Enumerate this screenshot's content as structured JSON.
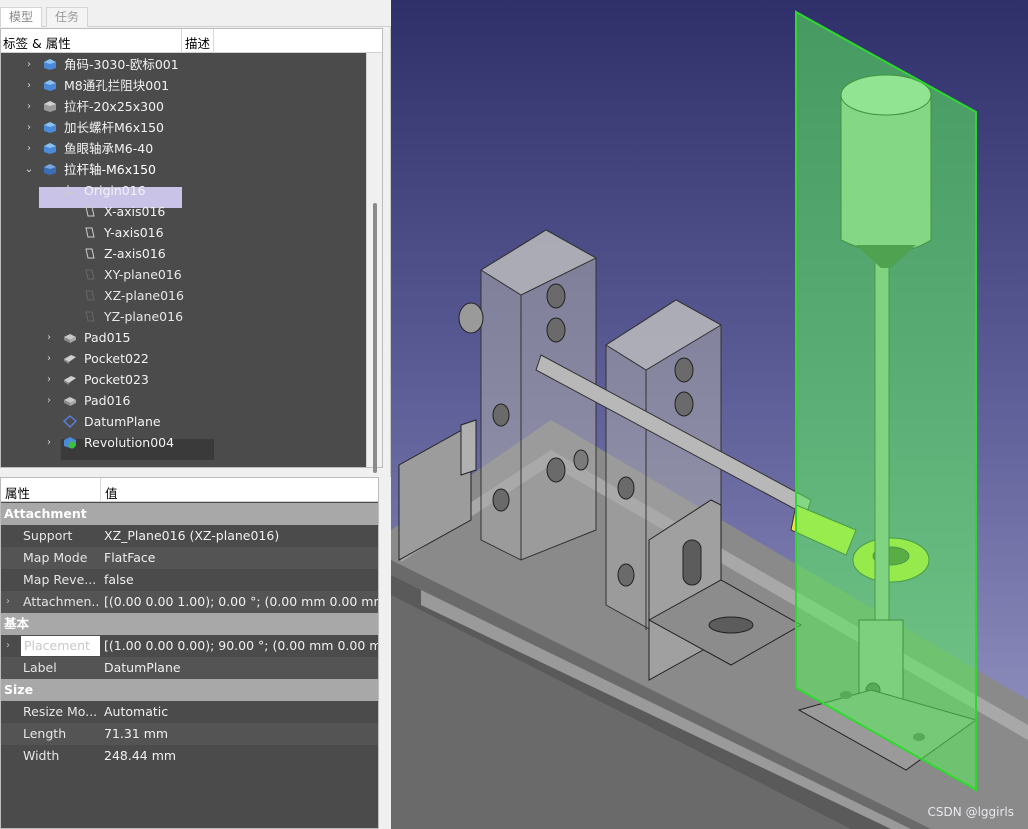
{
  "tabs": {
    "model": "模型",
    "task": "任务"
  },
  "tree": {
    "header": {
      "labels": "标签 & 属性",
      "description": "描述"
    },
    "items": [
      {
        "label": "角码-3030-欧标001",
        "icon": "part-link-icon"
      },
      {
        "label": "M8通孔拦阻块001",
        "icon": "part-link-icon"
      },
      {
        "label": "拉杆-20x25x300",
        "icon": "part-icon"
      },
      {
        "label": "加长螺杆M6x150",
        "icon": "part-link-icon"
      },
      {
        "label": "鱼眼轴承M6-40",
        "icon": "part-link-icon"
      },
      {
        "label": "拉杆轴-M6x150",
        "icon": "body-icon"
      },
      {
        "label": "Origin016",
        "icon": "origin-icon"
      },
      {
        "label": "X-axis016",
        "icon": "axis-icon"
      },
      {
        "label": "Y-axis016",
        "icon": "axis-icon"
      },
      {
        "label": "Z-axis016",
        "icon": "axis-icon"
      },
      {
        "label": "XY-plane016",
        "icon": "plane-icon"
      },
      {
        "label": "XZ-plane016",
        "icon": "plane-icon"
      },
      {
        "label": "YZ-plane016",
        "icon": "plane-icon"
      },
      {
        "label": "Pad015",
        "icon": "pad-icon"
      },
      {
        "label": "Pocket022",
        "icon": "pocket-icon"
      },
      {
        "label": "Pocket023",
        "icon": "pocket-icon"
      },
      {
        "label": "Pad016",
        "icon": "pad-icon"
      },
      {
        "label": "DatumPlane",
        "icon": "datum-plane-icon"
      },
      {
        "label": "Revolution004",
        "icon": "revolution-icon"
      }
    ]
  },
  "properties": {
    "header": {
      "property": "属性",
      "value": "值"
    },
    "groups": {
      "attachment": "Attachment",
      "base": "基本",
      "size": "Size"
    },
    "rows": {
      "support": {
        "key": "Support",
        "value": "XZ_Plane016 (XZ-plane016)"
      },
      "map_mode": {
        "key": "Map Mode",
        "value": "FlatFace"
      },
      "map_reversed": {
        "key": "Map Reve...",
        "value": "false"
      },
      "attachment_offset": {
        "key": "Attachmen...",
        "value": "[(0.00 0.00 1.00); 0.00 °; (0.00 mm  0.00 mm  ..."
      },
      "placement": {
        "key": "Placement",
        "value": "[(1.00 0.00 0.00); 90.00 °; (0.00 mm  0.00 mm..."
      },
      "label": {
        "key": "Label",
        "value": "DatumPlane"
      },
      "resize_mode": {
        "key": "Resize Mo...",
        "value": "Automatic"
      },
      "length": {
        "key": "Length",
        "value": "71.31 mm"
      },
      "width": {
        "key": "Width",
        "value": "248.44 mm"
      }
    }
  },
  "viewport": {
    "watermark": "CSDN @lggirls"
  },
  "colors": {
    "tree_bg": "#4b4b4b",
    "selection": "#c9c3e8",
    "datum_plane": "#5cf05c",
    "group_header": "#a8a8a8"
  }
}
